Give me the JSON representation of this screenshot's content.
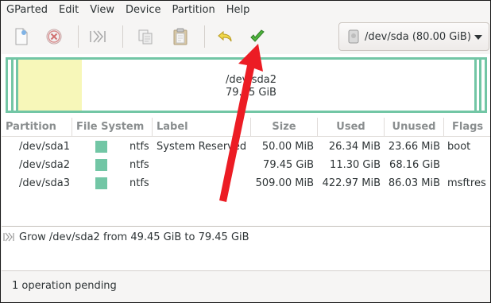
{
  "menu": [
    "GParted",
    "Edit",
    "View",
    "Device",
    "Partition",
    "Help"
  ],
  "toolbar": {
    "buttons": [
      "new-partition",
      "delete-partition",
      "resize-move",
      "copy",
      "paste",
      "undo",
      "apply"
    ],
    "device": "/dev/sda (80.00 GiB)"
  },
  "visual": {
    "partition_name": "/dev/sda2",
    "partition_size": "79.45 GiB",
    "used_fraction": 0.14
  },
  "table": {
    "headers": [
      "Partition",
      "File System",
      "Label",
      "Size",
      "Used",
      "Unused",
      "Flags"
    ],
    "rows": [
      {
        "partition": "/dev/sda1",
        "filesystem": "ntfs",
        "label": "System Reserved",
        "size": "50.00 MiB",
        "used": "26.34 MiB",
        "unused": "23.66 MiB",
        "flags": "boot"
      },
      {
        "partition": "/dev/sda2",
        "filesystem": "ntfs",
        "label": "",
        "size": "79.45 GiB",
        "used": "11.30 GiB",
        "unused": "68.16 GiB",
        "flags": ""
      },
      {
        "partition": "/dev/sda3",
        "filesystem": "ntfs",
        "label": "",
        "size": "509.00 MiB",
        "used": "422.97 MiB",
        "unused": "86.03 MiB",
        "flags": "msftres"
      }
    ]
  },
  "operations": [
    "Grow /dev/sda2 from 49.45 GiB to 79.45 GiB"
  ],
  "status": "1 operation pending",
  "colors": {
    "ntfs": "#72c6a5",
    "used": "#f7f7b9",
    "annotation": "#ec1c24"
  }
}
